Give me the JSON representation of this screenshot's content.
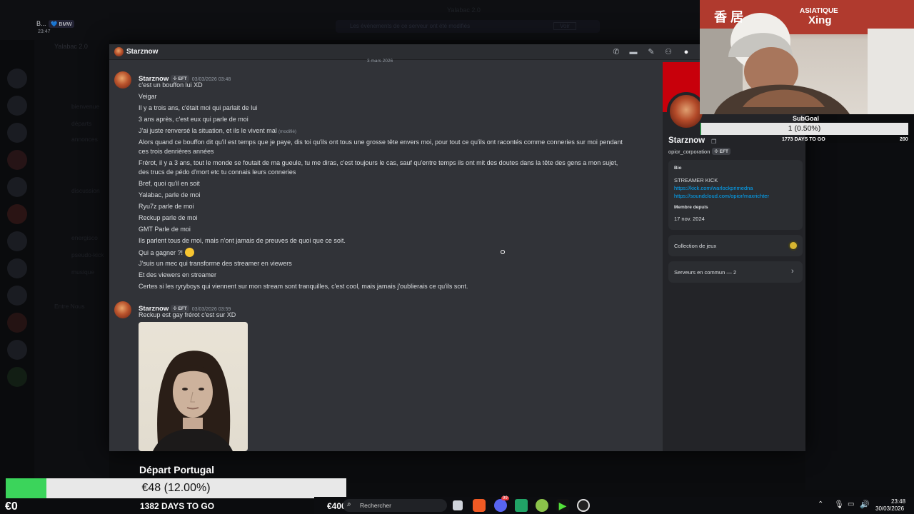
{
  "background": {
    "top_user": "B...",
    "top_badge": "💙 BMW",
    "top_time": "23:47",
    "server_title": "Yalabac 2.0",
    "top_center": "Yalabac 2.0",
    "notice": "Les événements de ce serveur ont été modifiés",
    "notice_button": "Voir",
    "channels": [
      "bienvenue",
      "départs",
      "annonces",
      "discussion",
      "energisco",
      "pseudo-kick",
      "musique"
    ],
    "category": "Entre Nous"
  },
  "window": {
    "title": "Starznow",
    "date_divider": "3 mars 2026",
    "messages": [
      {
        "author": "Starznow",
        "tag": "EFT",
        "time": "03/03/2026 03:48",
        "lines": [
          "c'est un bouffon lui XD",
          "Veigar",
          "Il y a trois ans, c'était moi qui parlait de lui",
          "3 ans après, c'est eux qui parle de moi",
          "J'ai juste renversé la situation, et ils le vivent mal",
          "Alors quand ce bouffon dit qu'il est temps que je paye, dis toi qu'ils ont tous une grosse tête envers moi, pour tout ce qu'ils ont racontés comme conneries sur moi pendant",
          "ces trois denrières années",
          "Frérot, il y a 3 ans, tout le monde se foutait de ma gueule, tu me diras, c'est toujours le cas, sauf qu'entre temps ils ont mit des doutes dans la tête des gens a mon sujet,",
          "des trucs de pédo d'mort etc tu connais leurs conneries",
          "Bref, quoi qu'il en soit",
          "Yalabac, parle de moi",
          "Ryu7z parle de moi",
          "Reckup parle de moi",
          "GMT Parle de moi",
          "Ils parlent tous de moi, mais n'ont jamais de preuves de quoi que ce soit.",
          "Qui a gagner ?!",
          "J'suis un mec qui transforme des streamer en viewers",
          "Et des viewers en streamer",
          "Certes si les ryryboys qui viennent sur mon stream sont tranquilles, c'est cool, mais jamais j'oublierais ce qu'ils sont."
        ],
        "edited_label": "(modifié)"
      },
      {
        "author": "Starznow",
        "tag": "EFT",
        "time": "03/03/2026 03:59",
        "lines": [
          "Reckup est gay frérot c'est sur XD"
        ]
      }
    ],
    "header_icons": [
      "call-icon",
      "video-icon",
      "pin-icon",
      "add-member-icon",
      "profile-icon"
    ]
  },
  "profile": {
    "name": "Starznow",
    "username": "opior_corporation",
    "tag": "EFT",
    "bio_label": "Bio",
    "bio_text": "STREAMER KICK",
    "links": [
      "https://kick.com/warlockprimedna",
      "https://soundcloud.com/opior/maxrichter"
    ],
    "member_label": "Membre depuis",
    "member_date": "17 nov. 2024",
    "games_label": "Collection de jeux",
    "servers_label": "Serveurs en commun — 2"
  },
  "overlay": {
    "subgoal_label": "SubGoal",
    "subgoal_text": "1 (0.50%)",
    "subgoal_fraction": 0.005,
    "subgoal_days": "1773 DAYS TO GO",
    "subgoal_target": "200",
    "goal_title": "Départ Portugal",
    "goal_text": "€48 (12.00%)",
    "goal_fraction": 0.12,
    "goal_start": "€0",
    "goal_days": "1382 DAYS TO GO",
    "goal_target": "€400",
    "cam_sign": "ASIATIQUE",
    "cam_sign2": "Xing",
    "cam_chars": "香 居"
  },
  "taskbar": {
    "search_placeholder": "Rechercher",
    "clock_time": "23:48",
    "clock_date": "30/03/2026",
    "discord_badge": "99"
  },
  "colors": {
    "accent": "#5865f2",
    "goal_green": "#3bd45b",
    "link": "#00a8fc",
    "banner_red": "#c8000b"
  }
}
